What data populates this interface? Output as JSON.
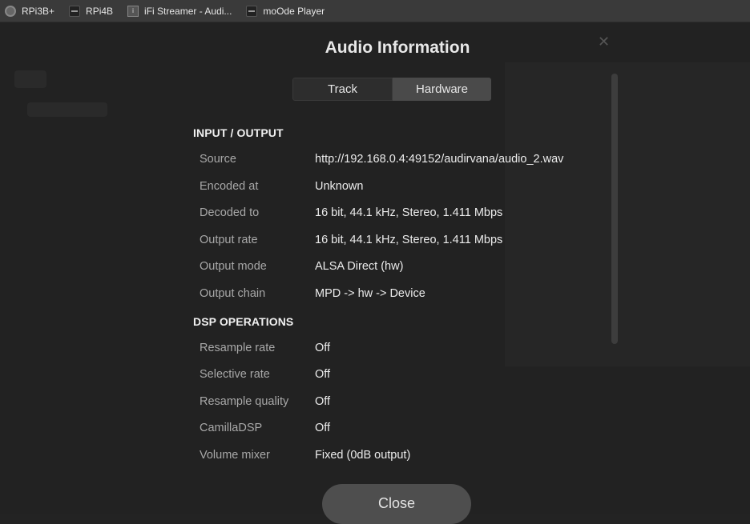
{
  "bookmarks": [
    {
      "label": "RPi3B+",
      "icon": "rpi-icon"
    },
    {
      "label": "RPi4B",
      "icon": "rpi-icon"
    },
    {
      "label": "iFi Streamer - Audi...",
      "icon": "ifi-icon"
    },
    {
      "label": "moOde Player",
      "icon": "moode-icon"
    }
  ],
  "modal": {
    "title": "Audio Information",
    "tabs": [
      {
        "label": "Track",
        "active": false
      },
      {
        "label": "Hardware",
        "active": true
      }
    ],
    "sections": [
      {
        "title": "INPUT / OUTPUT",
        "rows": [
          {
            "label": "Source",
            "value": "http://192.168.0.4:49152/audirvana/audio_2.wav"
          },
          {
            "label": "Encoded at",
            "value": "Unknown"
          },
          {
            "label": "Decoded to",
            "value": "16 bit, 44.1 kHz, Stereo, 1.411 Mbps"
          },
          {
            "label": "Output rate",
            "value": "16 bit, 44.1 kHz, Stereo, 1.411 Mbps"
          },
          {
            "label": "Output mode",
            "value": "ALSA Direct (hw)"
          },
          {
            "label": "Output chain",
            "value": "MPD -> hw -> Device"
          }
        ]
      },
      {
        "title": "DSP OPERATIONS",
        "rows": [
          {
            "label": "Resample rate",
            "value": "Off"
          },
          {
            "label": "Selective rate",
            "value": "Off"
          },
          {
            "label": "Resample quality",
            "value": "Off"
          },
          {
            "label": "CamillaDSP",
            "value": "Off"
          },
          {
            "label": "Volume mixer",
            "value": "Fixed (0dB output)"
          }
        ]
      }
    ],
    "close_label": "Close",
    "dismiss_glyph": "✕"
  }
}
